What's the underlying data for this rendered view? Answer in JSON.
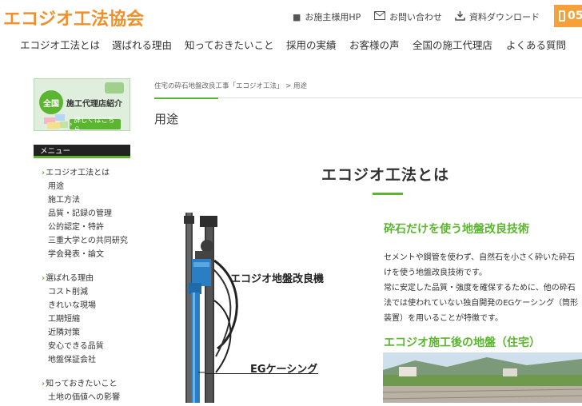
{
  "header": {
    "logo_text": "エコジオ工法協会",
    "links": [
      {
        "label": "お施主様用HP",
        "icon": "square-bullet-icon"
      },
      {
        "label": "お問い合わせ",
        "icon": "mail-icon"
      },
      {
        "label": "資料ダウンロード",
        "icon": "download-icon"
      }
    ],
    "phone_partial": "05"
  },
  "nav": {
    "items": [
      "エコジオ工法とは",
      "選ばれる理由",
      "知っておきたいこと",
      "採用の実績",
      "お客様の声",
      "全国の施工代理店",
      "よくある質問"
    ]
  },
  "sidebar": {
    "banner": {
      "circle_text": "全国",
      "title": "施工代理店紹介",
      "cta": "詳しくはこちら"
    },
    "menu_header": "メニュー",
    "groups": [
      {
        "title": "エコジオ工法とは",
        "items": [
          "用途",
          "施工方法",
          "品質・記録の管理",
          "公的認定・特許",
          "三重大学との共同研究",
          "学会発表・論文"
        ]
      },
      {
        "title": "選ばれる理由",
        "items": [
          "コスト削減",
          "きれいな現場",
          "工期短縮",
          "近隣対策",
          "安心できる品質",
          "地盤保証会社"
        ]
      },
      {
        "title": "知っておきたいこと",
        "items": [
          "土地の価値への影響"
        ]
      }
    ]
  },
  "main": {
    "breadcrumb": "住宅の砕石地盤改良工事「エコジオ工法」 > 用途",
    "page_title": "用途",
    "section_title": "エコジオ工法とは",
    "machine_label": "エコジオ地盤改良機",
    "casing_label": "EGケーシング",
    "heading1": "砕石だけを使う地盤改良技術",
    "body_lines": [
      "セメントや鋼管を使わず、自然石を小さく砕いた砕石",
      "けを使う地盤改良技術です。",
      "常に安定した品質・強度を確保するために、他の砕石",
      "法では使われていない独自開発のEGケーシング（筒形",
      "装置）を用いることが特徴です。"
    ],
    "heading2": "エコジオ施工後の地盤（住宅）"
  },
  "colors": {
    "brand_orange": "#f0902a",
    "accent_green": "#5cb531",
    "machine_blue": "#2a7fc4"
  }
}
